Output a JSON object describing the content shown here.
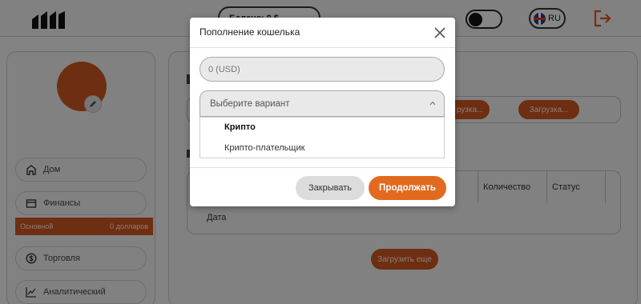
{
  "header": {
    "pill_text": "Баланс: 0 $",
    "lang_label": "RU"
  },
  "sidebar": {
    "items": [
      {
        "label": "Дом",
        "icon": "home-icon"
      },
      {
        "label": "Финансы",
        "icon": "wallet-icon"
      },
      {
        "label": "Торговля",
        "icon": "dollar-icon"
      },
      {
        "label": "Аналитический",
        "icon": "chart-icon"
      }
    ],
    "finance_sub": {
      "name": "Основной",
      "value": "0 долларов"
    }
  },
  "main": {
    "load_buttons": [
      "Загрузка...",
      "Загрузка..."
    ],
    "table_headers": [
      "Количество",
      "Статус"
    ],
    "date_header": "Дата",
    "load_more": "Загрузить еще"
  },
  "modal": {
    "title": "Пополнение кошелька",
    "amount_placeholder": "0 (USD)",
    "select_placeholder": "Выберите вариант",
    "options": [
      {
        "label": "Крипто",
        "selected": true
      },
      {
        "label": "Крипто-плательщик",
        "selected": false
      }
    ],
    "close_label": "Закрывать",
    "continue_label": "Продолжать"
  },
  "colors": {
    "accent": "#e26a1f",
    "brand_dark": "#c8551f"
  }
}
